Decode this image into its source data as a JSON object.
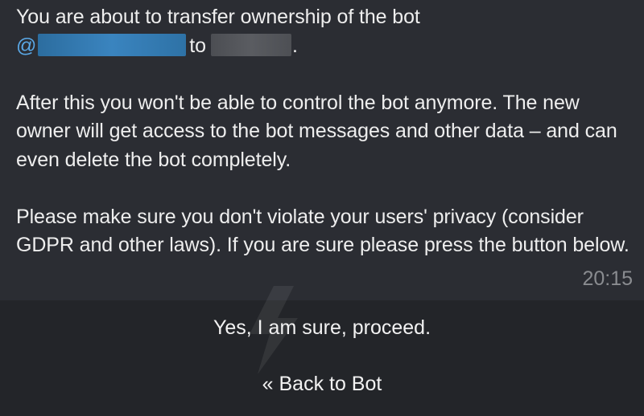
{
  "message": {
    "line1": "You are about to transfer ownership of the bot",
    "at_symbol": "@",
    "to_word": "to",
    "period": ".",
    "para2": "After this you won't be able to control the bot anymore. The new owner will get access to the bot messages and other data – and can even delete the bot completely.",
    "para3": "Please make sure you don't violate your users' privacy (consider GDPR and other laws). If you are sure please press the button below.",
    "time": "20:15"
  },
  "keyboard": {
    "confirm_label": "Yes, I am sure, proceed.",
    "back_label": "« Back to Bot"
  },
  "colors": {
    "accent": "#5aa8e6",
    "background": "#232529",
    "bubble": "#2b2d33"
  }
}
